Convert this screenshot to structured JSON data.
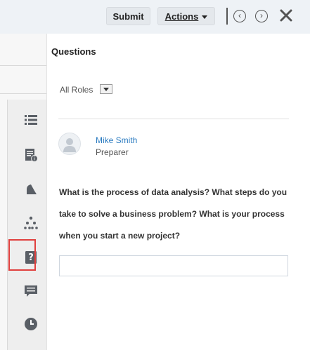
{
  "toolbar": {
    "submit_label": "Submit",
    "actions_label": "Actions",
    "prev_glyph": "‹",
    "next_glyph": "›"
  },
  "panel": {
    "title": "Questions",
    "roles_filter": "All Roles",
    "user": {
      "name": "Mike Smith",
      "role": "Preparer"
    },
    "question_text": "What is the process of data analysis? What steps do you take to solve a business problem? What is your process when you start a new project?",
    "answer_value": ""
  },
  "rail": {
    "items": [
      "list-icon",
      "report-icon",
      "bell-icon",
      "hierarchy-icon",
      "question-icon",
      "comment-icon",
      "clock-icon"
    ],
    "selected": "question-icon"
  },
  "colors": {
    "accent_link": "#2b7bc0",
    "highlight": "#e0403e",
    "rail_icon": "#5a5f66"
  }
}
